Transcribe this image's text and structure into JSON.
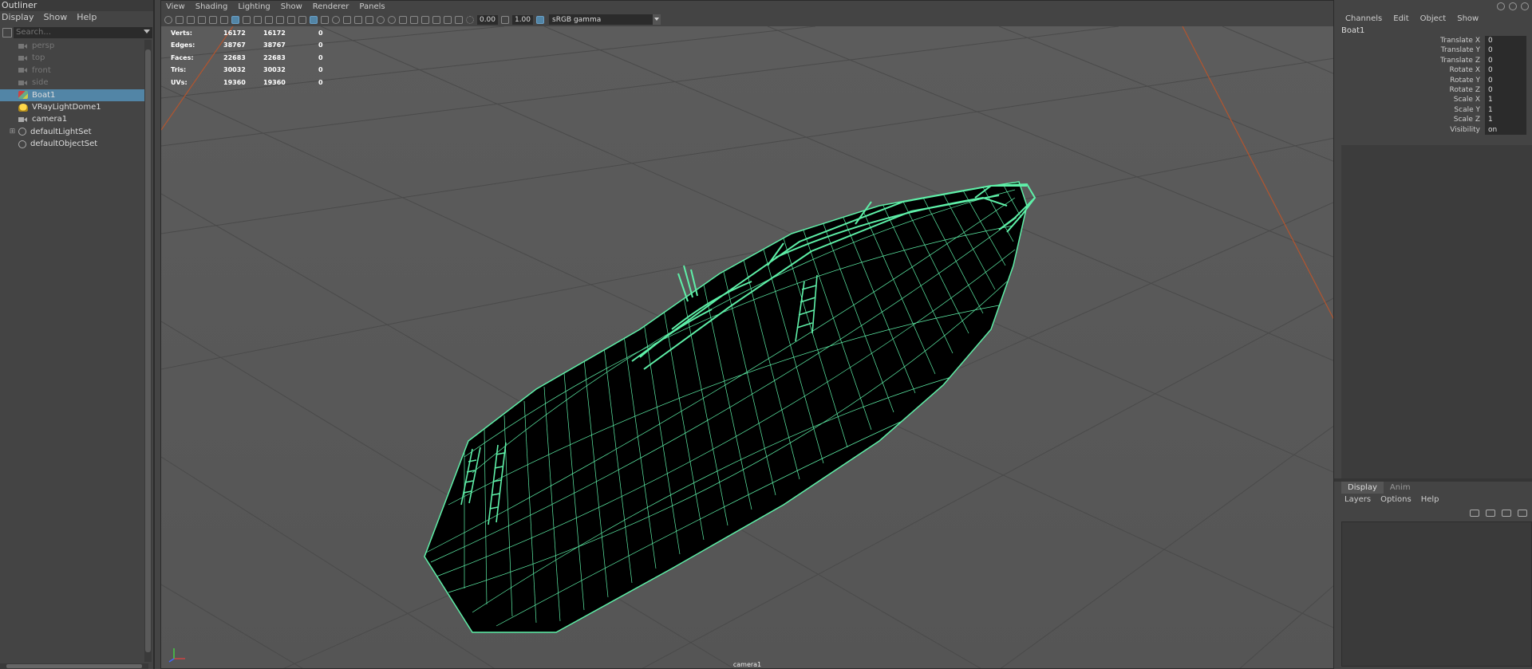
{
  "outliner": {
    "title": "Outliner",
    "menu": [
      "Display",
      "Show",
      "Help"
    ],
    "search_placeholder": "Search...",
    "items": [
      {
        "label": "persp",
        "icon": "camera-icon",
        "dimmed": true
      },
      {
        "label": "top",
        "icon": "camera-icon",
        "dimmed": true
      },
      {
        "label": "front",
        "icon": "camera-icon",
        "dimmed": true
      },
      {
        "label": "side",
        "icon": "camera-icon",
        "dimmed": true
      },
      {
        "label": "Boat1",
        "icon": "mesh-icon",
        "selected": true
      },
      {
        "label": "VRayLightDome1",
        "icon": "dome-light-icon"
      },
      {
        "label": "camera1",
        "icon": "camera-icon"
      },
      {
        "label": "defaultLightSet",
        "icon": "set-icon",
        "expandable": true
      },
      {
        "label": "defaultObjectSet",
        "icon": "set-icon"
      }
    ]
  },
  "viewport": {
    "menu": [
      "View",
      "Shading",
      "Lighting",
      "Show",
      "Renderer",
      "Panels"
    ],
    "exposure": "0.00",
    "gamma": "1.00",
    "color_management": "sRGB gamma",
    "camera_name": "camera1",
    "wireframe_color": "#5ef0a8",
    "hud": [
      {
        "label": "Verts:",
        "v1": "16172",
        "v2": "16172",
        "v3": "0"
      },
      {
        "label": "Edges:",
        "v1": "38767",
        "v2": "38767",
        "v3": "0"
      },
      {
        "label": "Faces:",
        "v1": "22683",
        "v2": "22683",
        "v3": "0"
      },
      {
        "label": "Tris:",
        "v1": "30032",
        "v2": "30032",
        "v3": "0"
      },
      {
        "label": "UVs:",
        "v1": "19360",
        "v2": "19360",
        "v3": "0"
      }
    ]
  },
  "channel_box": {
    "menu": [
      "Channels",
      "Edit",
      "Object",
      "Show"
    ],
    "object_name": "Boat1",
    "attributes": [
      {
        "name": "Translate X",
        "value": "0"
      },
      {
        "name": "Translate Y",
        "value": "0"
      },
      {
        "name": "Translate Z",
        "value": "0"
      },
      {
        "name": "Rotate X",
        "value": "0"
      },
      {
        "name": "Rotate Y",
        "value": "0"
      },
      {
        "name": "Rotate Z",
        "value": "0"
      },
      {
        "name": "Scale X",
        "value": "1"
      },
      {
        "name": "Scale Y",
        "value": "1"
      },
      {
        "name": "Scale Z",
        "value": "1"
      },
      {
        "name": "Visibility",
        "value": "on"
      }
    ]
  },
  "layer_editor": {
    "tabs": [
      "Display",
      "Anim"
    ],
    "menu": [
      "Layers",
      "Options",
      "Help"
    ]
  }
}
